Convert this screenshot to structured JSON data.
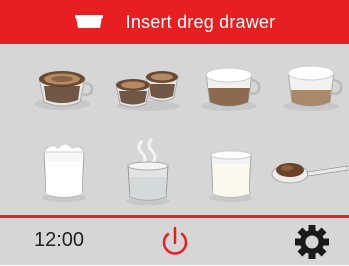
{
  "header": {
    "message": "Insert dreg drawer",
    "icon": "dreg-drawer-icon",
    "background": "#e81f22"
  },
  "drinks": [
    {
      "icon": "espresso-icon"
    },
    {
      "icon": "double-espresso-icon"
    },
    {
      "icon": "cappuccino-icon"
    },
    {
      "icon": "latte-macchiato-icon"
    },
    {
      "icon": "milk-froth-icon"
    },
    {
      "icon": "hot-water-icon"
    },
    {
      "icon": "warm-milk-icon"
    },
    {
      "icon": "ground-coffee-spoon-icon"
    }
  ],
  "footer": {
    "time": "12:00",
    "power_icon": "power-icon",
    "settings_icon": "gear-icon",
    "accent": "#e81f22"
  }
}
